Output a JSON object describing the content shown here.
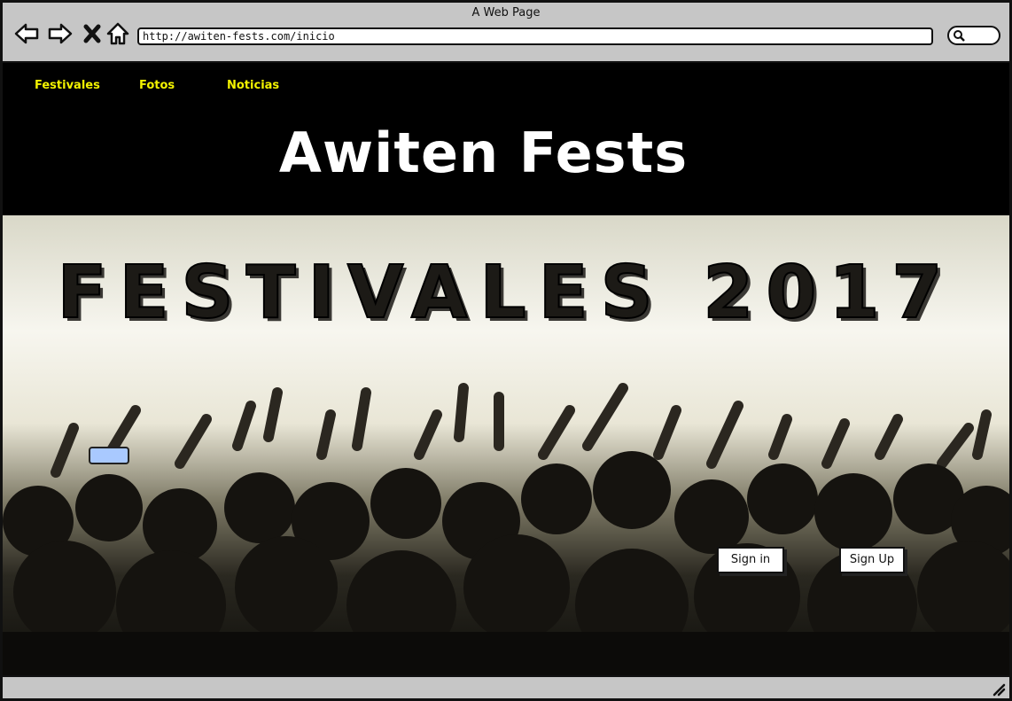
{
  "window": {
    "title": "A Web Page"
  },
  "browser": {
    "url": "http://awiten-fests.com/inicio"
  },
  "nav": {
    "items": [
      "Festivales",
      "Fotos",
      "Noticias"
    ]
  },
  "site": {
    "title": "Awiten Fests"
  },
  "hero": {
    "title": "FESTIVALES 2017"
  },
  "auth": {
    "signin_label": "Sign in",
    "signup_label": "Sign Up"
  },
  "colors": {
    "accent": "#f2f200",
    "header_bg": "#000000",
    "chrome": "#c6c6c6"
  }
}
